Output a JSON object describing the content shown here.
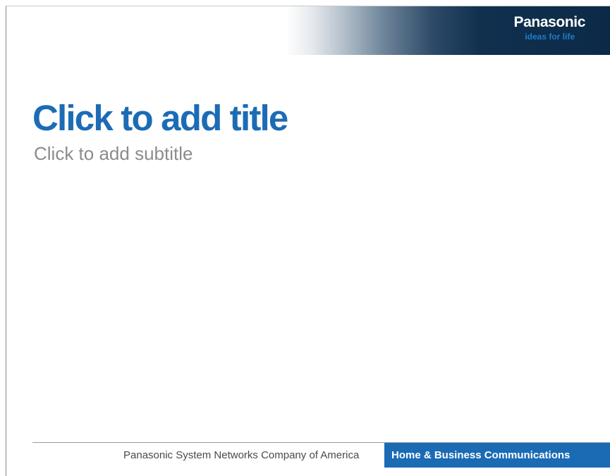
{
  "header": {
    "brand_name": "Panasonic",
    "brand_tagline": "ideas for life"
  },
  "slide": {
    "title_placeholder": "Click to add title",
    "subtitle_placeholder": "Click to add subtitle"
  },
  "footer": {
    "company": "Panasonic System Networks Company of America",
    "division": "Home & Business Communications"
  },
  "colors": {
    "title_blue": "#1c6cb5",
    "tagline_blue": "#1b7fc8",
    "footer_band_blue": "#1a6bb4",
    "header_navy": "#0c2a48",
    "subtitle_gray": "#8c8c8c"
  }
}
